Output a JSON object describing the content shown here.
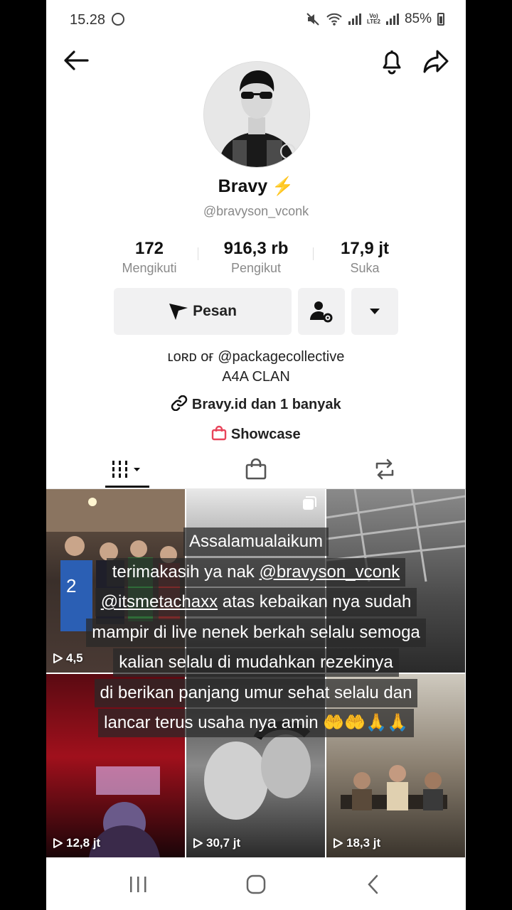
{
  "status_bar": {
    "time": "15.28",
    "battery": "85%"
  },
  "profile": {
    "name": "Bravy",
    "verified_glyph": "⚡",
    "handle": "@bravyson_vconk",
    "stats": [
      {
        "value": "172",
        "label": "Mengikuti"
      },
      {
        "value": "916,3 rb",
        "label": "Pengikut"
      },
      {
        "value": "17,9 jt",
        "label": "Suka"
      }
    ],
    "message_button": "Pesan",
    "bio_line1": "ʟᴏʀᴅ ᴏғ @packagecollective",
    "bio_line2": "A4A CLAN",
    "link_text": "Bravy.id dan 1 banyak",
    "showcase_text": "Showcase"
  },
  "tabs": [
    {
      "icon": "videos-grid-icon",
      "selected": true
    },
    {
      "icon": "shopping-bag-icon",
      "selected": false
    },
    {
      "icon": "repost-icon",
      "selected": false
    }
  ],
  "videos": [
    {
      "views": "4,5"
    },
    {
      "views": ""
    },
    {
      "views": ""
    },
    {
      "views": "12,8 jt"
    },
    {
      "views": "30,7 jt"
    },
    {
      "views": "18,3 jt"
    }
  ],
  "overlay_caption": {
    "line1": "Assalamualaikum",
    "line2_pre": "terimakasih ya nak ",
    "line2_mention": "@bravyson_vconk",
    "line3_mention": "@itsmetachaxx",
    "line3_post": " atas kebaikan nya sudah",
    "line4": "mampir di live nenek berkah selalu semoga",
    "line5": "kalian selalu di mudahkan rezekinya",
    "line6": "di berikan panjang umur sehat selalu dan",
    "line7": "lancar terus usaha nya amin 🤲🤲🙏🙏"
  },
  "colors": {
    "accent_bolt": "#f5c242",
    "showcase_bag": "#e8445a"
  }
}
